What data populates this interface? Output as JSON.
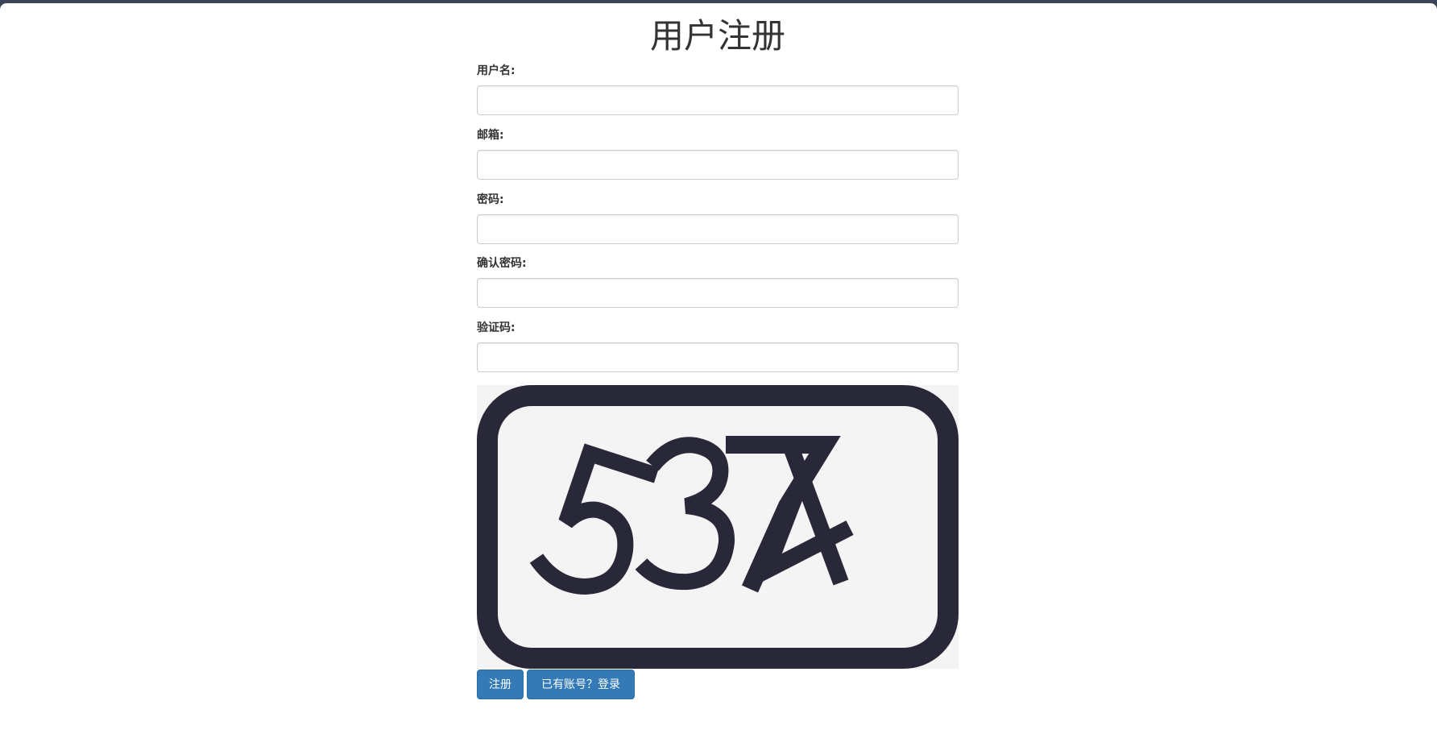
{
  "page": {
    "title": "用户注册"
  },
  "form": {
    "fields": [
      {
        "label": "用户名:",
        "value": "",
        "placeholder": ""
      },
      {
        "label": "邮箱:",
        "value": "",
        "placeholder": ""
      },
      {
        "label": "密码:",
        "value": "",
        "placeholder": ""
      },
      {
        "label": "确认密码:",
        "value": "",
        "placeholder": ""
      },
      {
        "label": "验证码:",
        "value": "",
        "placeholder": ""
      }
    ]
  },
  "captcha": {
    "code": "5374",
    "frame_color": "#282838",
    "background_color": "#f4f4f4"
  },
  "actions": {
    "register_label": "注册",
    "login_label": "已有账号？登录",
    "button_color": "#337ab7"
  }
}
